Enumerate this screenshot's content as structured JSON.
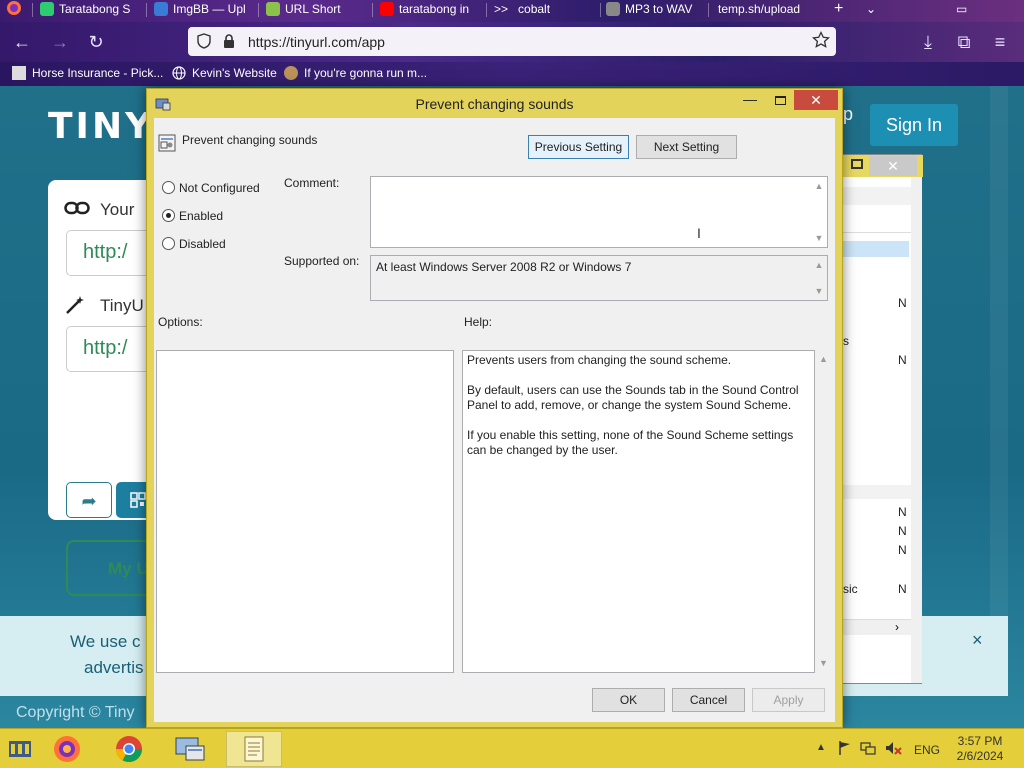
{
  "browser": {
    "tabs": [
      {
        "title": "Taratabong S",
        "color": "#2ecc71"
      },
      {
        "title": "ImgBB — Upl",
        "color": "#3a7bd5"
      },
      {
        "title": "URL Short",
        "color": "#8bc34a"
      },
      {
        "title": "taratabong in",
        "color": "#ff0000"
      },
      {
        "title": "cobalt",
        "color": "#222222"
      },
      {
        "title": "MP3 to WAV",
        "color": "#888888"
      },
      {
        "title": "temp.sh/upload",
        "color": "#888888"
      }
    ],
    "url": "https://tinyurl.com/app",
    "bookmarks": [
      {
        "title": "Horse Insurance - Pick..."
      },
      {
        "title": "Kevin's Website"
      },
      {
        "title": "If you're gonna run m..."
      }
    ]
  },
  "page": {
    "logo": "TINY",
    "signup": "Up",
    "signin": "Sign In",
    "card_label_1": "Your",
    "card_input_1": "http:/",
    "card_label_2": "TinyU",
    "card_input_2": "http:/",
    "my_urls": "My U",
    "cookie_line1": "We use c",
    "cookie_line2": "advertis",
    "cookie_close": "×",
    "copyright": "Copyright © Tiny"
  },
  "gp_window": {
    "rows": [
      {
        "text": "N"
      },
      {
        "text": "s"
      },
      {
        "text": "N"
      },
      {
        "text": "N"
      },
      {
        "text": "N"
      },
      {
        "text": "N"
      },
      {
        "text": "sic",
        "n": "N"
      }
    ]
  },
  "dialog": {
    "title": "Prevent changing sounds",
    "setting_name": "Prevent changing sounds",
    "prev_btn": "Previous Setting",
    "next_btn": "Next Setting",
    "radio_not_configured": "Not Configured",
    "radio_enabled": "Enabled",
    "radio_disabled": "Disabled",
    "selected": "Enabled",
    "comment_label": "Comment:",
    "comment_value": "",
    "supported_label": "Supported on:",
    "supported_value": "At least Windows Server 2008 R2 or Windows 7",
    "options_label": "Options:",
    "help_label": "Help:",
    "help_text": "Prevents users from changing the sound scheme.\n\nBy default, users can use the Sounds tab in the Sound Control Panel to add, remove, or change the system Sound Scheme.\n\nIf you enable this setting, none of the Sound Scheme settings can be changed by the user.",
    "ok": "OK",
    "cancel": "Cancel",
    "apply": "Apply"
  },
  "taskbar": {
    "lang": "ENG",
    "time": "3:57 PM",
    "date": "2/6/2024"
  },
  "colors": {
    "dialog_frame": "#e4d35a",
    "close_red": "#c84b3d",
    "taskbar": "#e4cf3a",
    "tinyurl_teal": "#20708a"
  }
}
